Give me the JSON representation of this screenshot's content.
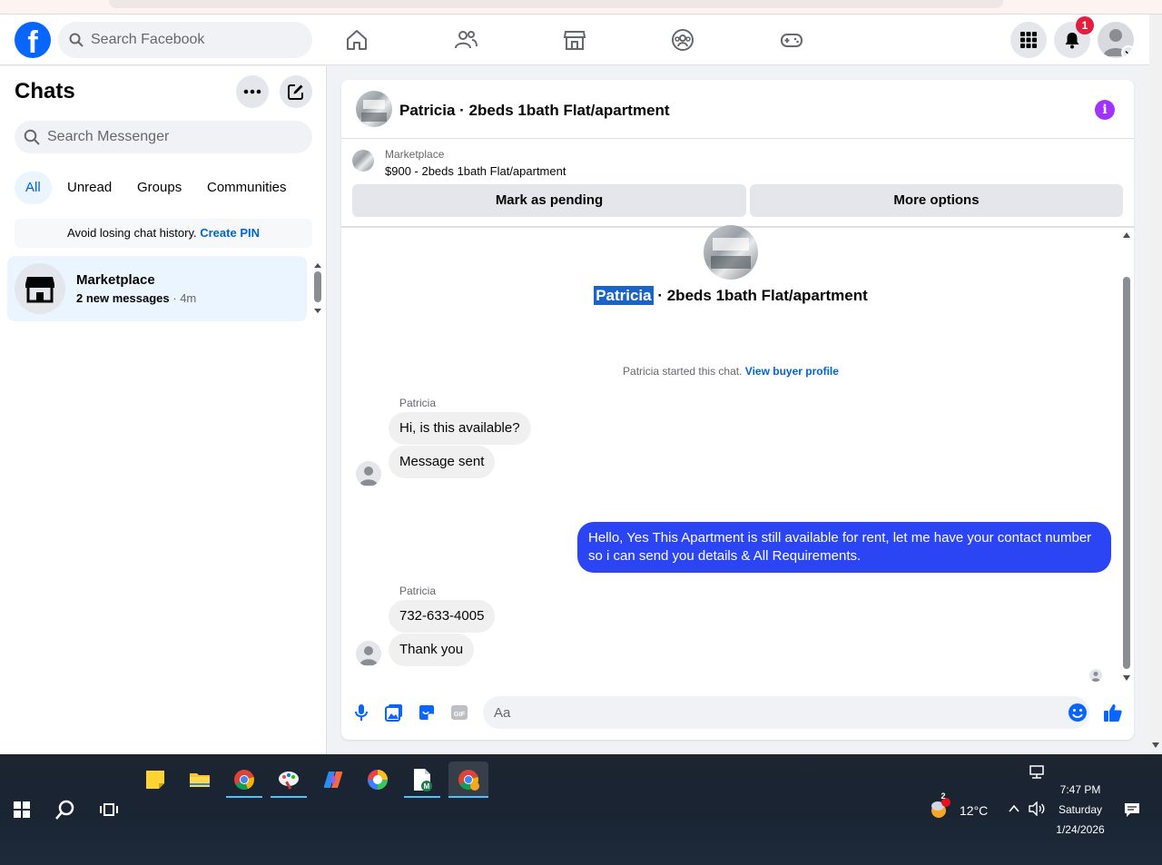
{
  "topnav": {
    "logo": "f",
    "search_placeholder": "Search Facebook",
    "notification_count": "1"
  },
  "sidebar": {
    "title": "Chats",
    "search_placeholder": "Search Messenger",
    "filters": [
      "All",
      "Unread",
      "Groups",
      "Communities"
    ],
    "pin_notice": "Avoid losing chat history.",
    "pin_link": "Create PIN",
    "chat": {
      "name": "Marketplace",
      "preview": "2 new messages",
      "separator": " · ",
      "time": "4m"
    }
  },
  "conversation": {
    "title": "Patricia · 2beds 1bath Flat/apartment",
    "marketplace_label": "Marketplace",
    "listing": "$900 - 2beds 1bath Flat/apartment",
    "mark_pending": "Mark as pending",
    "more_options": "More options",
    "center_name": "Patricia",
    "center_rest": " · 2beds 1bath Flat/apartment",
    "started_text": "Patricia started this chat.",
    "buyer_link": "View buyer profile",
    "messages": [
      {
        "sender": "Patricia",
        "text": "Hi, is this available?"
      },
      {
        "text": "Message sent"
      },
      {
        "text": "Hello, Yes This Apartment is still available for rent, let me have your contact number so i can send you details & All Requirements."
      },
      {
        "sender": "Patricia",
        "text": "732-633-4005"
      },
      {
        "text": "Thank you"
      }
    ],
    "composer_placeholder": "Aa"
  },
  "taskbar": {
    "weather_badge": "2",
    "temperature": "12°C",
    "time": "7:47 PM",
    "day": "Saturday",
    "date": "1/24/2026"
  },
  "colors": {
    "fb_blue": "#0866ff",
    "outgoing_bubble": "#2b45f5",
    "link": "#0064d1",
    "badge_red": "#e41e3f",
    "info_purple": "#a033ff"
  }
}
